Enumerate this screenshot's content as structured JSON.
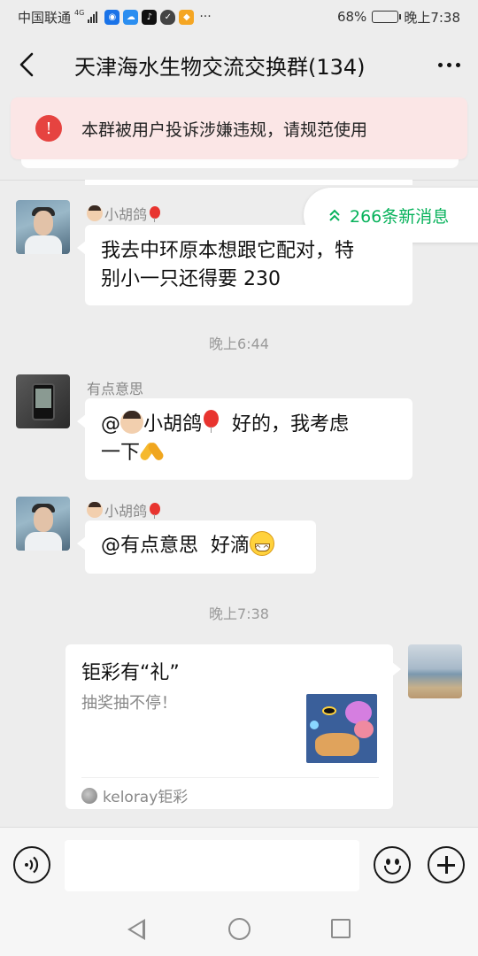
{
  "status_bar": {
    "carrier": "中国联通",
    "network": "4G",
    "battery": "68%",
    "battery_level": 0.68,
    "time": "晚上7:38"
  },
  "header": {
    "title": "天津海水生物交流交换群(134)",
    "back_icon": "chevron-left-icon",
    "more_icon": "more-dots-icon"
  },
  "warning": {
    "icon": "!",
    "text": "本群被用户投诉涉嫌违规，请规范使用"
  },
  "new_messages": {
    "label": "266条新消息"
  },
  "messages": [
    {
      "sender": "小胡鸽",
      "text": [
        "我去中环原本想跟它配对，特",
        "别小一只还得要 230"
      ]
    },
    {
      "sender": "有点意思",
      "mention": "@",
      "mention_name": "小胡鸽",
      "text_after": "好的，我考虑",
      "text_line2": "一下"
    },
    {
      "sender": "小胡鸽",
      "text": "@有点意思  好滴"
    }
  ],
  "timestamps": [
    "晚上6:44",
    "晚上7:38"
  ],
  "card": {
    "title": "钜彩有“礼”",
    "description": "抽奖抽不停！",
    "source": "keloray钜彩"
  },
  "input_bar": {
    "voice_icon": "voice-icon",
    "emoji_icon": "emoji-icon",
    "plus_icon": "plus-icon",
    "value": ""
  },
  "nav_bar": {
    "icons": [
      "nav-back-icon",
      "nav-home-icon",
      "nav-recent-icon"
    ]
  }
}
